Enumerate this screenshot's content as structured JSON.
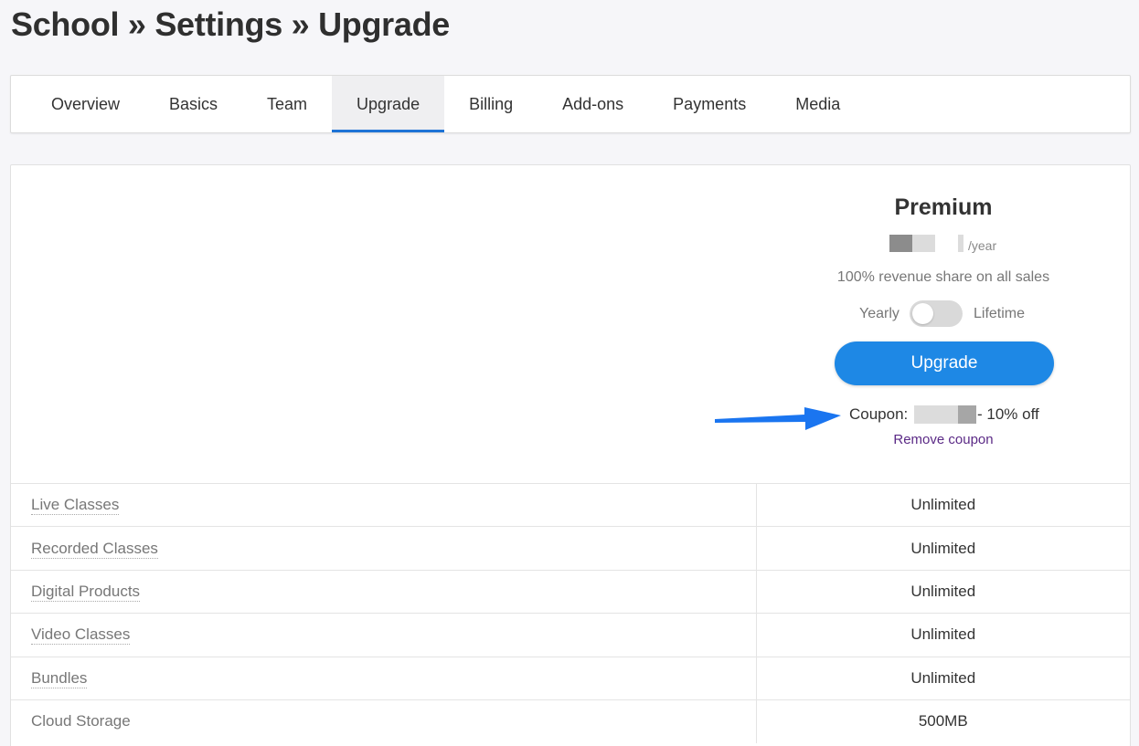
{
  "breadcrumb": "School » Settings » Upgrade",
  "tabs": [
    {
      "label": "Overview",
      "active": false
    },
    {
      "label": "Basics",
      "active": false
    },
    {
      "label": "Team",
      "active": false
    },
    {
      "label": "Upgrade",
      "active": true
    },
    {
      "label": "Billing",
      "active": false
    },
    {
      "label": "Add-ons",
      "active": false
    },
    {
      "label": "Payments",
      "active": false
    },
    {
      "label": "Media",
      "active": false
    }
  ],
  "plan": {
    "name": "Premium",
    "per_period": "/year",
    "revenue_share": "100% revenue share on all sales",
    "toggle": {
      "left_label": "Yearly",
      "right_label": "Lifetime",
      "on": false
    },
    "upgrade_label": "Upgrade",
    "coupon_label": "Coupon:",
    "coupon_discount": "- 10% off",
    "remove_coupon_label": "Remove coupon"
  },
  "features": [
    {
      "name": "Live Classes",
      "value": "Unlimited",
      "tooltip": true
    },
    {
      "name": "Recorded Classes",
      "value": "Unlimited",
      "tooltip": true
    },
    {
      "name": "Digital Products",
      "value": "Unlimited",
      "tooltip": true
    },
    {
      "name": "Video Classes",
      "value": "Unlimited",
      "tooltip": true
    },
    {
      "name": "Bundles",
      "value": "Unlimited",
      "tooltip": true
    },
    {
      "name": "Cloud Storage",
      "value": "500MB",
      "tooltip": false
    }
  ],
  "colors": {
    "accent": "#1e88e5",
    "tab_underline": "#1e73d6",
    "link": "#5b2a86",
    "arrow": "#1a75f0"
  }
}
